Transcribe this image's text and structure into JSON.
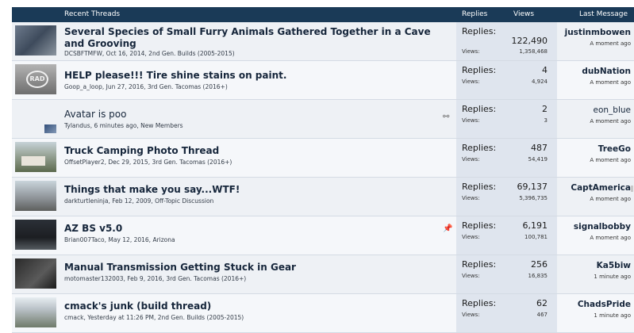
{
  "header": {
    "section_title": "Recent Threads",
    "col_replies": "Replies",
    "col_views": "Views",
    "col_last": "Last Message"
  },
  "colors": {
    "header_bg": "#1a3a57",
    "row_bg": "#eef1f5",
    "stats_bg": "#dfe5ee",
    "title_text": "#16263b"
  },
  "labels": {
    "replies": "Replies:",
    "views": "Views:"
  },
  "threads": [
    {
      "title": "Several Species of Small Furry Animals Gathered Together in a Cave and Grooving",
      "meta": "DCSBFTMFW, Oct 16, 2014, 2nd Gen. Builds (2005-2015)",
      "replies": "122,490",
      "views": "1,358,468",
      "last_user": "justinmbowen",
      "last_time": "A moment ago",
      "icon": ""
    },
    {
      "title": "HELP please!!! Tire shine stains on paint.",
      "meta": "Goop_a_loop, Jun 27, 2016, 3rd Gen. Tacomas (2016+)",
      "replies": "4",
      "views": "4,924",
      "last_user": "dubNation",
      "last_time": "A moment ago",
      "icon": "",
      "thumb_text": "RAD"
    },
    {
      "title": "Avatar is poo",
      "meta": "Tylandus, 6 minutes ago, New Members",
      "replies": "2",
      "views": "3",
      "last_user": "eon_blue",
      "last_time": "A moment ago",
      "icon": "link-icon",
      "icon_glyph": "⚯"
    },
    {
      "title": "Truck Camping Photo Thread",
      "meta": "OffsetPlayer2, Dec 29, 2015, 3rd Gen. Tacomas (2016+)",
      "replies": "487",
      "views": "54,419",
      "last_user": "TreeGo",
      "last_time": "A moment ago",
      "icon": ""
    },
    {
      "title": "Things that make you say...WTF!",
      "meta": "darkturtleninja, Feb 12, 2009, Off-Topic Discussion",
      "replies": "69,137",
      "views": "5,396,735",
      "last_user": "CaptAmerica",
      "last_time": "A moment ago",
      "icon": ""
    },
    {
      "title": "AZ BS v5.0",
      "meta": "Brian007Taco, May 12, 2016, Arizona",
      "replies": "6,191",
      "views": "100,781",
      "last_user": "signalbobby",
      "last_time": "A moment ago",
      "icon": "pin-icon",
      "icon_glyph": "📌"
    },
    {
      "title": "Manual Transmission Getting Stuck in Gear",
      "meta": "motomaster132003, Feb 9, 2016, 3rd Gen. Tacomas (2016+)",
      "replies": "256",
      "views": "16,835",
      "last_user": "Ka5biw",
      "last_time": "1 minute ago",
      "icon": ""
    },
    {
      "title": "cmack's junk (build thread)",
      "meta": "cmack, Yesterday at 11:26 PM, 2nd Gen. Builds (2005-2015)",
      "replies": "62",
      "views": "467",
      "last_user": "ChadsPride",
      "last_time": "1 minute ago",
      "icon": ""
    }
  ]
}
